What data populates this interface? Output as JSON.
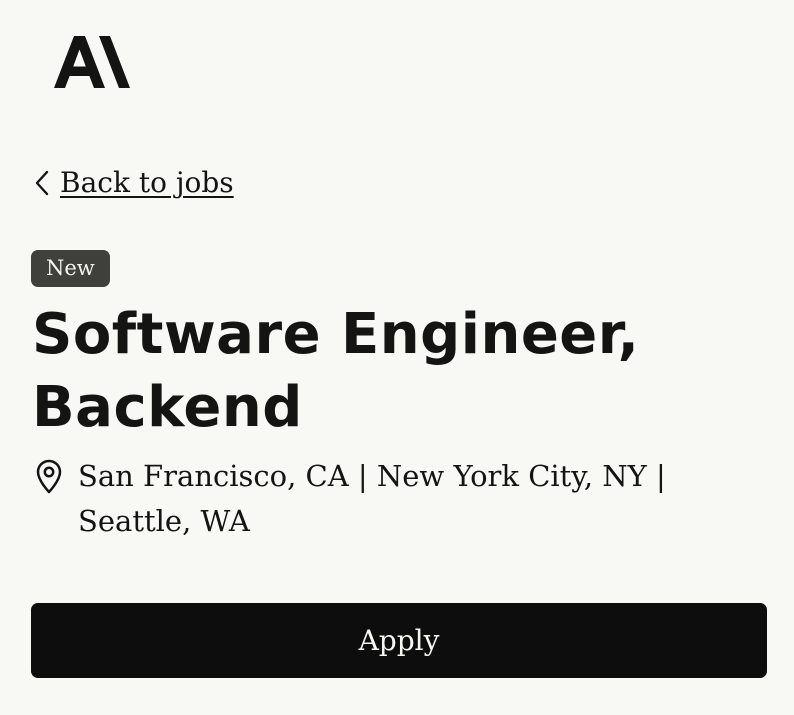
{
  "brand": {
    "logo_icon": "anthropic-logo-icon"
  },
  "nav": {
    "back_label": "Back to jobs",
    "back_icon": "chevron-left-icon"
  },
  "job": {
    "badge": "New",
    "title": "Software Engineer, Backend",
    "location_icon": "map-pin-icon",
    "location": "San Francisco, CA | New York City, NY | Seattle, WA"
  },
  "actions": {
    "apply_label": "Apply"
  },
  "colors": {
    "background": "#f8f8f4",
    "text": "#141413",
    "badge_background": "#3f3f3c",
    "button_background": "#0d0d0d",
    "button_text": "#f7f7f2"
  }
}
